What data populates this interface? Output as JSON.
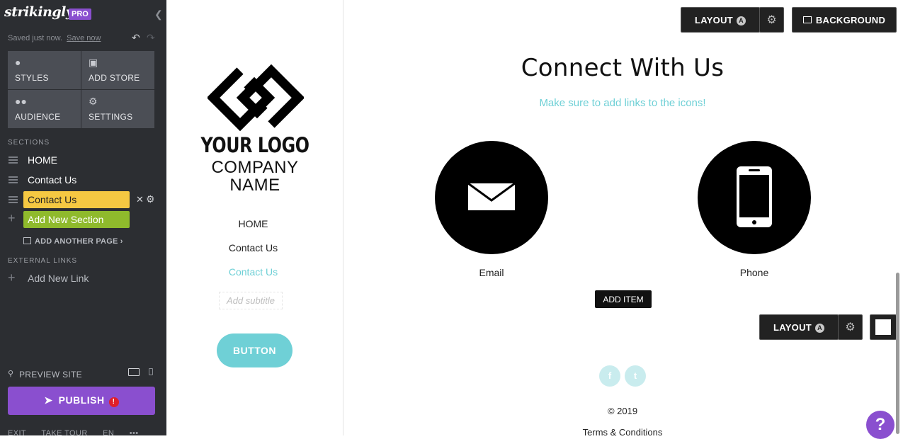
{
  "editor": {
    "brand": "strikingly",
    "plan_badge": "PRO",
    "save_status": "Saved just now.",
    "save_now_link": "Save now",
    "tools": [
      {
        "label": "STYLES",
        "icon": "palette-icon"
      },
      {
        "label": "ADD STORE",
        "icon": "store-icon"
      },
      {
        "label": "AUDIENCE",
        "icon": "people-icon"
      },
      {
        "label": "SETTINGS",
        "icon": "gear-icon"
      }
    ],
    "sections_heading": "SECTIONS",
    "sections": [
      {
        "label": "HOME"
      },
      {
        "label": "Contact Us"
      }
    ],
    "editing_section_value": "Contact Us",
    "new_section_value": "Add New Section",
    "add_page_label": "ADD ANOTHER PAGE",
    "external_links_heading": "EXTERNAL LINKS",
    "add_link_label": "Add New Link",
    "preview_label": "PREVIEW SITE",
    "publish_label": "PUBLISH",
    "publish_alert": "!",
    "footer": {
      "exit": "EXIT",
      "tour": "TAKE TOUR",
      "lang": "EN",
      "more": "•••"
    },
    "accent_color": "#8a4fcf"
  },
  "site_nav": {
    "logo_line1": "YOUR LOGO",
    "logo_line2": "COMPANY",
    "logo_line3": "NAME",
    "links": [
      {
        "label": "HOME"
      },
      {
        "label": "Contact Us"
      },
      {
        "label": "Contact Us"
      }
    ],
    "subtitle_placeholder": "Add subtitle",
    "button_label": "BUTTON",
    "accent_color": "#6fd0d6"
  },
  "canvas": {
    "layout_label": "LAYOUT",
    "layout_badge": "A",
    "background_label": "BACKGROUND",
    "title": "Connect With Us",
    "subtitle": "Make sure to add links to the icons!",
    "items": [
      {
        "label": "Email",
        "icon": "envelope-icon"
      },
      {
        "label": "Phone",
        "icon": "phone-icon"
      }
    ],
    "add_item_label": "ADD ITEM",
    "social": [
      "f",
      "t"
    ],
    "copyright": "© 2019",
    "terms": "Terms & Conditions",
    "help": "?"
  }
}
